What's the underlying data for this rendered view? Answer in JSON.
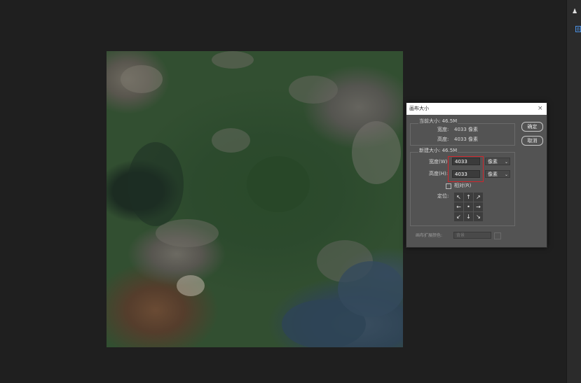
{
  "dialog": {
    "title": "画布大小",
    "close_icon": "×",
    "current_size_label": "当前大小: 46.5M",
    "current_width_label": "宽度:",
    "current_width_value": "4033 像素",
    "current_height_label": "高度:",
    "current_height_value": "4033 像素",
    "new_size_label": "新建大小: 46.5M",
    "width_label": "宽度(W):",
    "width_value": "4033",
    "height_label": "高度(H):",
    "height_value": "4033",
    "unit_label": "像素",
    "relative_label": "相对(R)",
    "relative_checked": false,
    "anchor_label": "定位:",
    "anchor_arrows": [
      "↖",
      "↑",
      "↗",
      "←",
      "•",
      "→",
      "↙",
      "↓",
      "↘"
    ],
    "extension_color_label": "画布扩展颜色:",
    "extension_color_value": "背景",
    "ok_label": "确定",
    "cancel_label": "取消"
  },
  "colors": {
    "workspace": "#1f1f1f",
    "dialog_bg": "#535353",
    "highlight": "#d0262c"
  }
}
